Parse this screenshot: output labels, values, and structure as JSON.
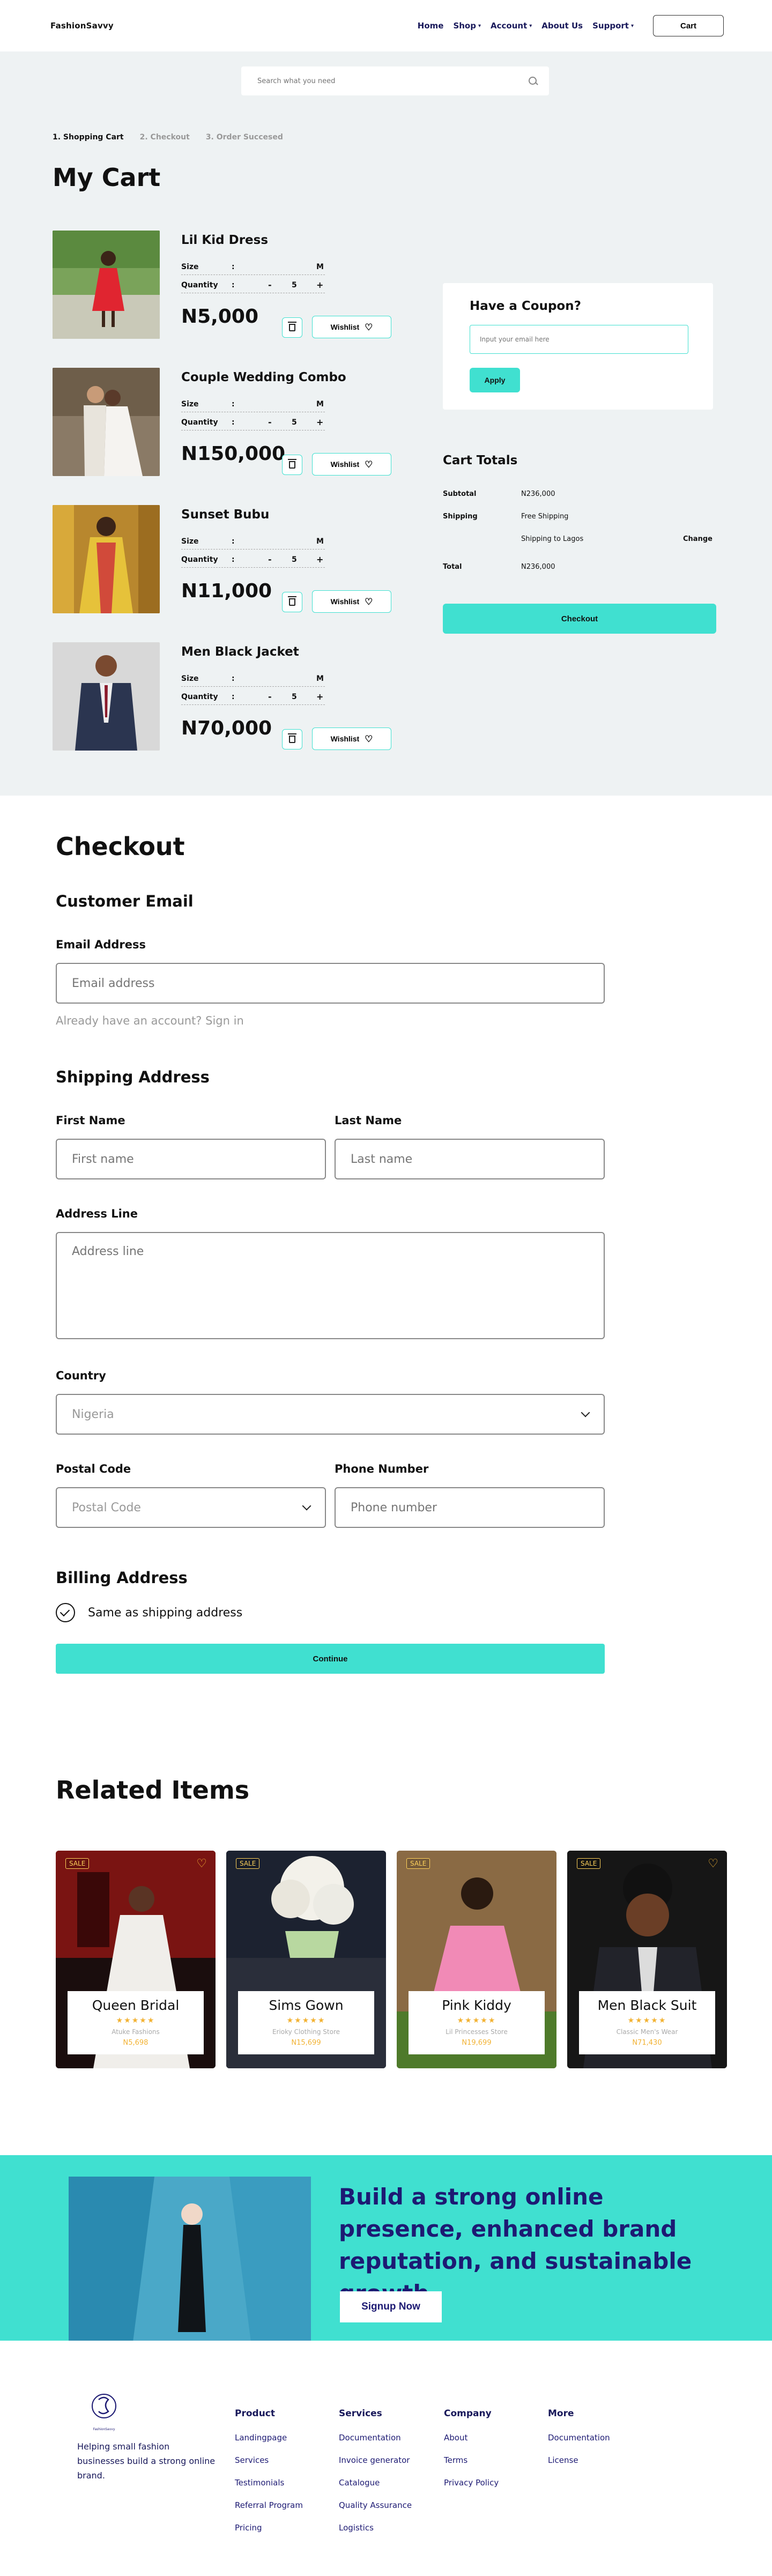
{
  "header": {
    "logo": "FashionSavvy",
    "nav": [
      {
        "label": "Home",
        "dropdown": false
      },
      {
        "label": "Shop",
        "dropdown": true
      },
      {
        "label": "Account",
        "dropdown": true
      },
      {
        "label": "About Us",
        "dropdown": false
      },
      {
        "label": "Support",
        "dropdown": true
      }
    ],
    "cart_button": "Cart"
  },
  "search": {
    "placeholder": "Search what you need"
  },
  "steps": [
    "1. Shopping Cart",
    "2. Checkout",
    "3. Order Succesed"
  ],
  "cart": {
    "title": "My Cart",
    "size_label": "Size",
    "quantity_label": "Quantity",
    "colon": ":",
    "minus": "-",
    "plus": "+",
    "wishlist_label": "Wishlist",
    "items": [
      {
        "name": "Lil Kid Dress",
        "size": "M",
        "quantity": "5",
        "price": "N5,000"
      },
      {
        "name": "Couple Wedding Combo",
        "size": "M",
        "quantity": "5",
        "price": "N150,000"
      },
      {
        "name": "Sunset Bubu",
        "size": "M",
        "quantity": "5",
        "price": "N11,000"
      },
      {
        "name": "Men Black Jacket",
        "size": "M",
        "quantity": "5",
        "price": "N70,000"
      }
    ]
  },
  "coupon": {
    "title": "Have a Coupon?",
    "placeholder": "Input your email here",
    "button": "Apply"
  },
  "totals": {
    "title": "Cart Totals",
    "subtotal_label": "Subtotal",
    "subtotal": "N236,000",
    "shipping_label": "Shipping",
    "shipping": "Free Shipping",
    "shipping_to": "Shipping to Lagos",
    "change": "Change",
    "total_label": "Total",
    "total": "N236,000",
    "checkout_button": "Checkout"
  },
  "checkout": {
    "title": "Checkout",
    "customer_email": "Customer Email",
    "email_label": "Email Address",
    "email_placeholder": "Email address",
    "signin_text": "Already have an account? Sign in",
    "shipping_address": "Shipping Address",
    "first_name_label": "First Name",
    "first_name_placeholder": "First name",
    "last_name_label": "Last Name",
    "last_name_placeholder": "Last name",
    "address_label": "Address Line",
    "address_placeholder": "Address line",
    "country_label": "Country",
    "country_value": "Nigeria",
    "postal_label": "Postal Code",
    "postal_value": "Postal Code",
    "phone_label": "Phone Number",
    "phone_placeholder": "Phone number",
    "billing_address": "Billing Address",
    "same_as_shipping": "Same as shipping address",
    "continue_button": "Continue"
  },
  "related": {
    "title": "Related Items",
    "sale_label": "SALE",
    "stars": "★★★★★",
    "items": [
      {
        "name": "Queen Bridal",
        "store": "Atuke Fashions",
        "price": "N5,698"
      },
      {
        "name": "Sims Gown",
        "store": "Erioky Clothing Store",
        "price": "N15,699"
      },
      {
        "name": "Pink Kiddy",
        "store": "Lil Princesses Store",
        "price": "N19,699"
      },
      {
        "name": "Men Black Suit",
        "store": "Classic Men's Wear",
        "price": "N71,430"
      }
    ]
  },
  "banner": {
    "headline": "Build a strong online presence, enhanced brand reputation, and sustainable growth",
    "button": "Signup Now"
  },
  "footer": {
    "logo_text": "FashionSavvy",
    "tagline": "Helping small fashion businesses build a strong online brand.",
    "columns": [
      {
        "title": "Product",
        "links": [
          "Landingpage",
          "Services",
          "Testimonials",
          "Referral Program",
          "Pricing"
        ]
      },
      {
        "title": "Services",
        "links": [
          "Documentation",
          "Invoice generator",
          "Catalogue",
          "Quality Assurance",
          "Logistics"
        ]
      },
      {
        "title": "Company",
        "links": [
          "About",
          "Terms",
          "Privacy Policy"
        ]
      },
      {
        "title": "More",
        "links": [
          "Documentation",
          "License"
        ]
      }
    ]
  },
  "colors": {
    "accent": "#40e0d0",
    "navy": "#1d1a73",
    "gold": "#f2b233",
    "bg": "#eef2f3"
  }
}
